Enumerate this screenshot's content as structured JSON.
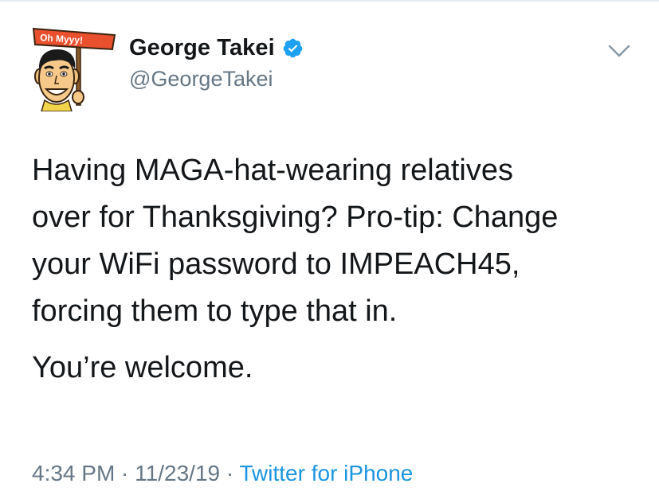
{
  "author": {
    "display_name": "George Takei",
    "handle": "@GeorgeTakei",
    "verified": true,
    "avatar_sign_text": "Oh Myyy!"
  },
  "tweet": {
    "lines": [
      "Having MAGA-hat-wearing relatives",
      "over for Thanksgiving? Pro-tip: Change",
      "your WiFi password to IMPEACH45,",
      "forcing them to type that in."
    ],
    "closing": "You’re welcome."
  },
  "meta": {
    "time": "4:34 PM",
    "separator1": " · ",
    "date": "11/23/19",
    "separator2": " · ",
    "source": "Twitter for iPhone"
  },
  "colors": {
    "text": "#14171a",
    "secondary": "#657786",
    "link": "#1b95e0",
    "verified": "#1da1f2",
    "sign": "#e8502e"
  },
  "icons": {
    "verified": "verified-badge-icon",
    "menu": "chevron-down-icon"
  }
}
